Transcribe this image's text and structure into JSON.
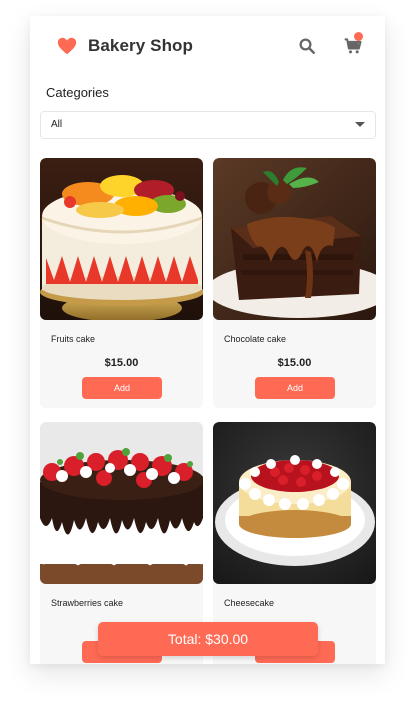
{
  "app": {
    "title": "Bakery Shop"
  },
  "header": {
    "search_icon": "search-icon",
    "cart_icon": "cart-icon",
    "brand_color": "#ff6a55"
  },
  "filters": {
    "categories_label": "Categories",
    "selected_category": "All"
  },
  "products": [
    {
      "name": "Fruits cake",
      "price": "$15.00",
      "button_label": "Add"
    },
    {
      "name": "Chocolate cake",
      "price": "$15.00",
      "button_label": "Add"
    },
    {
      "name": "Strawberries cake",
      "price": "",
      "button_label": ""
    },
    {
      "name": "Cheesecake",
      "price": "",
      "button_label": ""
    }
  ],
  "cart": {
    "total_label": "Total: $30.00"
  }
}
